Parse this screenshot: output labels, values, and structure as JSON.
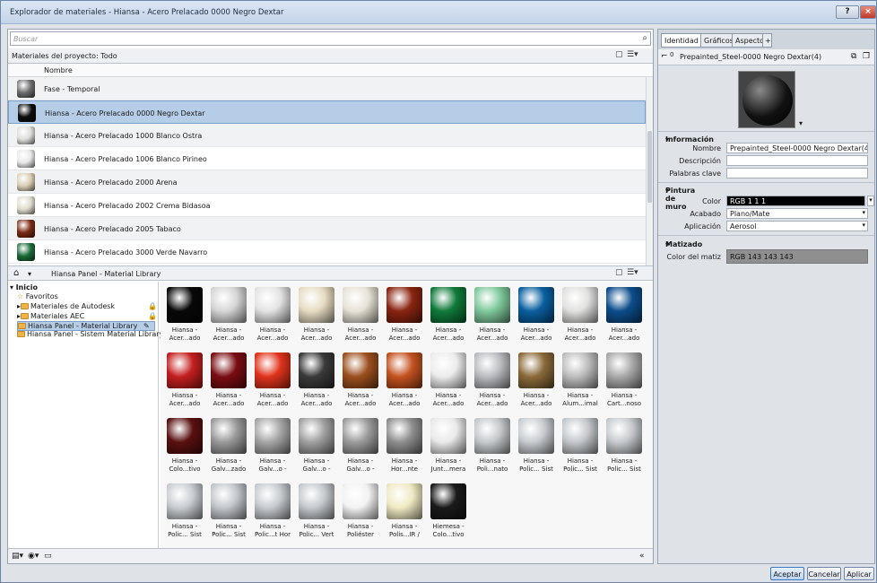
{
  "window": {
    "title": "Explorador de materiales - Hiansa - Acero Prelacado 0000 Negro Dextar"
  },
  "search": {
    "placeholder": "Buscar"
  },
  "project": {
    "label": "Materiales del proyecto: Todo",
    "column_header": "Nombre"
  },
  "materials": [
    {
      "name": "Fase - Temporal",
      "color": "#6d6d6d"
    },
    {
      "name": "Hiansa - Acero Prelacado 0000 Negro Dextar",
      "color": "#0d0d0d",
      "selected": true
    },
    {
      "name": "Hiansa - Acero Prelacado 1000 Blanco Ostra",
      "color": "#dcdcd8"
    },
    {
      "name": "Hiansa - Acero Prelacado 1006 Blanco Pirineo",
      "color": "#e8e8e8"
    },
    {
      "name": "Hiansa - Acero Prelacado 2000 Arena",
      "color": "#d9cdb2"
    },
    {
      "name": "Hiansa - Acero Prelacado 2002 Crema Bidasoa",
      "color": "#e0dbcc"
    },
    {
      "name": "Hiansa - Acero Prelacado 2005 Tabaco",
      "color": "#7a2a12"
    },
    {
      "name": "Hiansa - Acero Prelacado 3000 Verde Navarro",
      "color": "#1a6b37"
    }
  ],
  "library": {
    "breadcrumb": "Hiansa Panel - Material Library",
    "tree": [
      {
        "label": "Inicio",
        "level": 0
      },
      {
        "label": "Favoritos",
        "level": 1
      },
      {
        "label": "Materiales de Autodesk",
        "level": 1
      },
      {
        "label": "Materiales AEC",
        "level": 1
      },
      {
        "label": "Hiansa Panel - Material Library",
        "level": 1,
        "selected": true
      },
      {
        "label": "Hiansa Panel - Sistem Material Library",
        "level": 1
      }
    ],
    "tiles": [
      {
        "line1": "Hiansa -",
        "line2": "Acer...ado",
        "color": "#080808"
      },
      {
        "line1": "Hiansa -",
        "line2": "Acer...ado",
        "color": "#d6d6d6"
      },
      {
        "line1": "Hiansa -",
        "line2": "Acer...ado",
        "color": "#e4e4e4"
      },
      {
        "line1": "Hiansa -",
        "line2": "Acer...ado",
        "color": "#e7dcc2"
      },
      {
        "line1": "Hiansa -",
        "line2": "Acer...ado",
        "color": "#e6e2d6"
      },
      {
        "line1": "Hiansa -",
        "line2": "Acer...ado",
        "color": "#8a2411"
      },
      {
        "line1": "Hiansa -",
        "line2": "Acer...ado",
        "color": "#0f7a3a"
      },
      {
        "line1": "Hiansa -",
        "line2": "Acer...ado",
        "color": "#7fc89c"
      },
      {
        "line1": "Hiansa -",
        "line2": "Acer...ado",
        "color": "#0a5fa0"
      },
      {
        "line1": "Hiansa -",
        "line2": "Acer...ado",
        "color": "#e0e0de"
      },
      {
        "line1": "Hiansa -",
        "line2": "Acer...ado",
        "color": "#0c4d8c"
      },
      {
        "line1": "Hiansa -",
        "line2": "Acer...ado",
        "color": "#c51f1f"
      },
      {
        "line1": "Hiansa -",
        "line2": "Acer...ado",
        "color": "#7a0d12"
      },
      {
        "line1": "Hiansa -",
        "line2": "Acer...ado",
        "color": "#e0331c"
      },
      {
        "line1": "Hiansa -",
        "line2": "Acer...ado",
        "color": "#3a3a3a"
      },
      {
        "line1": "Hiansa -",
        "line2": "Acer...ado",
        "color": "#9c4f1e"
      },
      {
        "line1": "Hiansa -",
        "line2": "Acer...ado",
        "color": "#c4521f"
      },
      {
        "line1": "Hiansa -",
        "line2": "Acer...ado",
        "color": "#ececec"
      },
      {
        "line1": "Hiansa -",
        "line2": "Acer...ado",
        "color": "#b9bcc0"
      },
      {
        "line1": "Hiansa -",
        "line2": "Acer...ado",
        "color": "#8a6a3a"
      },
      {
        "line1": "Hiansa -",
        "line2": "Alum...imal",
        "color": "#bdbdbd"
      },
      {
        "line1": "Hiansa -",
        "line2": "Cart...noso",
        "color": "#a9a9a9"
      },
      {
        "line1": "Hiansa -",
        "line2": "Colo...tivo",
        "color": "#5a1010"
      },
      {
        "line1": "Hiansa -",
        "line2": "Galv...zado",
        "color": "#9a9a9a"
      },
      {
        "line1": "Hiansa -",
        "line2": "Galv...o -",
        "color": "#a6a6a6"
      },
      {
        "line1": "Hiansa -",
        "line2": "Galv...o -",
        "color": "#a0a0a0"
      },
      {
        "line1": "Hiansa -",
        "line2": "Galv...o -",
        "color": "#9c9c9c"
      },
      {
        "line1": "Hiansa -",
        "line2": "Hor...nte",
        "color": "#8e8e8e"
      },
      {
        "line1": "Hiansa -",
        "line2": "Junt...mera",
        "color": "#e9e9e9"
      },
      {
        "line1": "Hiansa -",
        "line2": "Poli...nato",
        "color": "#c5c9cc"
      },
      {
        "line1": "Hiansa -",
        "line2": "Polic... Sist",
        "color": "#c8ccd0"
      },
      {
        "line1": "Hiansa -",
        "line2": "Polic... Sist",
        "color": "#c4c8cc"
      },
      {
        "line1": "Hiansa -",
        "line2": "Polic... Sist",
        "color": "#c6cace"
      },
      {
        "line1": "Hiansa -",
        "line2": "Polic... Sist",
        "color": "#c9cdd1"
      },
      {
        "line1": "Hiansa -",
        "line2": "Polic... Sist",
        "color": "#c3c7cb"
      },
      {
        "line1": "Hiansa -",
        "line2": "Polic...t Hor",
        "color": "#c7cbcf"
      },
      {
        "line1": "Hiansa -",
        "line2": "Polic... Vert",
        "color": "#c5c9cd"
      },
      {
        "line1": "Hiansa -",
        "line2": "Poliéster",
        "color": "#f2f2f2"
      },
      {
        "line1": "Hiansa -",
        "line2": "Polis...IR /",
        "color": "#efe9c2"
      },
      {
        "line1": "Hiemesa -",
        "line2": "Colo...tivo",
        "color": "#1a1a1a"
      }
    ]
  },
  "tabs": [
    "Identidad",
    "Gráficos",
    "Aspecto"
  ],
  "tab_add": "+",
  "asset": {
    "counter": "0",
    "name": "Prepainted_Steel-0000 Negro Dextar(4)"
  },
  "info": {
    "section": "Información",
    "name_label": "Nombre",
    "name_value": "Prepainted_Steel-0000 Negro Dextar(4)",
    "desc_label": "Descripción",
    "desc_value": "",
    "keywords_label": "Palabras clave",
    "keywords_value": ""
  },
  "wallpaint": {
    "section": "Pintura de muro",
    "color_label": "Color",
    "color_value": "RGB 1 1 1",
    "finish_label": "Acabado",
    "finish_value": "Plano/Mate",
    "app_label": "Aplicación",
    "app_value": "Aerosol"
  },
  "tint": {
    "section": "Matizado",
    "color_label": "Color del matiz",
    "color_value": "RGB 143 143 143"
  },
  "buttons": {
    "accept": "Aceptar",
    "cancel": "Cancelar",
    "apply": "Aplicar"
  }
}
